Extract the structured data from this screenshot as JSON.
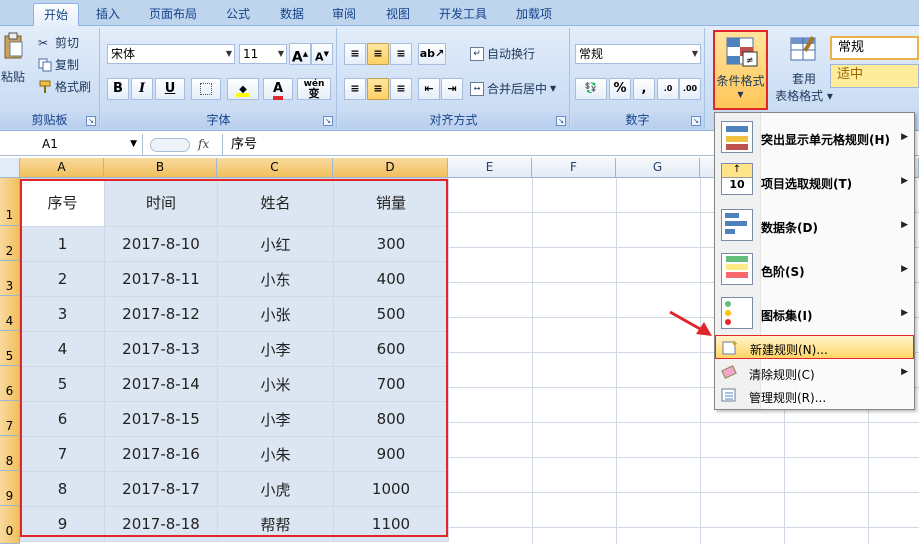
{
  "tabs": [
    {
      "label": "开始",
      "active": true
    },
    {
      "label": "插入"
    },
    {
      "label": "页面布局"
    },
    {
      "label": "公式"
    },
    {
      "label": "数据"
    },
    {
      "label": "审阅"
    },
    {
      "label": "视图"
    },
    {
      "label": "开发工具"
    },
    {
      "label": "加载项"
    }
  ],
  "clipboard": {
    "paste": "粘贴",
    "cut": "剪切",
    "copy": "复制",
    "format_painter": "格式刷",
    "group": "剪贴板"
  },
  "font": {
    "name": "宋体",
    "size": "11",
    "grow": "A",
    "shrink": "A",
    "bold": "B",
    "italic": "I",
    "underline": "U",
    "font_color": "A",
    "phonetic": "wén",
    "phonetic_char": "变",
    "group": "字体"
  },
  "alignment": {
    "wrap": "自动换行",
    "merge": "合并后居中",
    "group": "对齐方式"
  },
  "number": {
    "format": "常规",
    "percent": "%",
    "comma": ",",
    "group": "数字"
  },
  "styles": {
    "cond_format": "条件格式",
    "table_format": "套用",
    "table_format2": "表格格式",
    "style_normal": "常规",
    "style_neutral": "适中"
  },
  "formula_bar": {
    "cell_ref": "A1",
    "fx": "fx",
    "content": "序号"
  },
  "columns": [
    "A",
    "B",
    "C",
    "D",
    "E",
    "F",
    "G"
  ],
  "rows": [
    "1",
    "2",
    "3",
    "4",
    "5",
    "6",
    "7",
    "8",
    "9",
    "0"
  ],
  "table": {
    "headers": [
      "序号",
      "时间",
      "姓名",
      "销量"
    ],
    "rows": [
      [
        "1",
        "2017-8-10",
        "小红",
        "300"
      ],
      [
        "2",
        "2017-8-11",
        "小东",
        "400"
      ],
      [
        "3",
        "2017-8-12",
        "小张",
        "500"
      ],
      [
        "4",
        "2017-8-13",
        "小李",
        "600"
      ],
      [
        "5",
        "2017-8-14",
        "小米",
        "700"
      ],
      [
        "6",
        "2017-8-15",
        "小李",
        "800"
      ],
      [
        "7",
        "2017-8-16",
        "小朱",
        "900"
      ],
      [
        "8",
        "2017-8-17",
        "小虎",
        "1000"
      ],
      [
        "9",
        "2017-8-18",
        "帮帮",
        "1100"
      ]
    ]
  },
  "menu": {
    "highlight": "突出显示单元格规则(H)",
    "topbottom": "项目选取规则(T)",
    "databars": "数据条(D)",
    "colorscale": "色阶(S)",
    "iconsets": "图标集(I)",
    "new_rule": "新建规则(N)...",
    "clear_rules": "清除规则(C)",
    "manage_rules": "管理规则(R)...",
    "icon_number": "10"
  },
  "colors": {
    "accent_red": "#e1262b",
    "ribbon": "#d0e0f5",
    "selection": "#dce6f3"
  }
}
